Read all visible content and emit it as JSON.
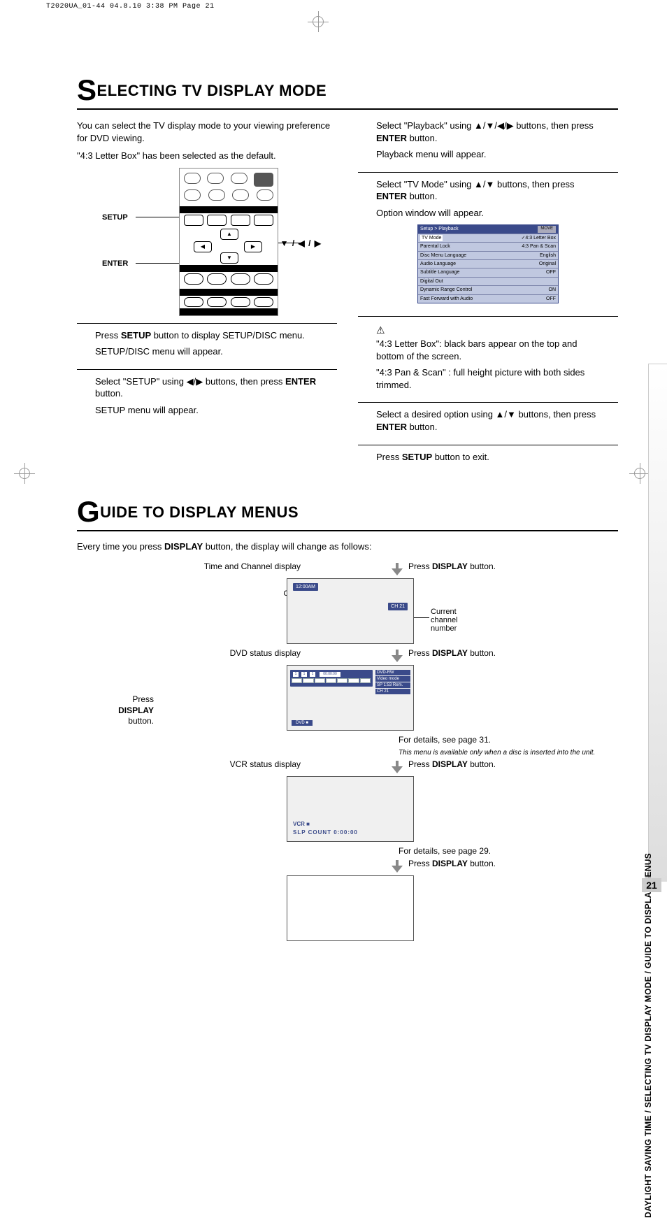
{
  "header_meta": "T2020UA_01-44  04.8.10 3:38 PM  Page 21",
  "section1": {
    "title_rest": "ELECTING TV DISPLAY MODE",
    "big": "S",
    "intro1": "You can select the TV display mode to your viewing preference for DVD viewing.",
    "intro2": "\"4:3 Letter Box\" has been selected as the default.",
    "remote": {
      "setup": "SETUP",
      "enter": "ENTER",
      "arrows": "▲ / ▼ / ◀ / ▶"
    },
    "left_steps": {
      "s1a": "Press SETUP button to display SETUP/DISC menu.",
      "s1b": "SETUP/DISC menu will appear.",
      "s2a": "Select \"SETUP\" using ◀/▶ buttons, then press ENTER button.",
      "s2b": "SETUP menu will appear."
    },
    "right_steps": {
      "s3a": "Select \"Playback\" using ▲/▼/◀/▶ buttons, then press ENTER button.",
      "s3b": "Playback menu will appear.",
      "s4a": "Select \"TV Mode\" using  ▲/▼ buttons, then press ENTER button.",
      "s4b": "Option window will appear.",
      "note1": "\"4:3 Letter Box\": black bars appear on the top and bottom of the screen.",
      "note2": "\"4:3 Pan & Scan\" : full height picture with both sides trimmed.",
      "s5a": "Select a desired option using ▲/▼ buttons, then press ENTER button.",
      "s6a": "Press SETUP button to exit."
    },
    "menu": {
      "title": "Setup > Playback",
      "move": "MOVE",
      "rows": [
        {
          "k": "TV Mode",
          "v": "✓4:3 Letter Box"
        },
        {
          "k": "Parental Lock",
          "v": "4:3 Pan & Scan"
        },
        {
          "k": "Disc Menu Language",
          "v": "English"
        },
        {
          "k": "Audio Language",
          "v": "Original"
        },
        {
          "k": "Subtitle Language",
          "v": "OFF"
        },
        {
          "k": "Digital Out",
          "v": ""
        },
        {
          "k": "Dynamic Range Control",
          "v": "ON"
        },
        {
          "k": "Fast Forward with Audio",
          "v": "OFF"
        }
      ]
    }
  },
  "section2": {
    "big": "G",
    "title_rest": "UIDE TO DISPLAY MENUS",
    "intro": "Every time you press DISPLAY button, the display will change as follows:",
    "labels": {
      "time_channel": "Time and Channel display",
      "current_time": "Current time",
      "current_channel": "Current channel number",
      "dvd": "DVD status display",
      "vcr": "VCR status display",
      "press": "Press DISPLAY button.",
      "left_press": "Press DISPLAY button."
    },
    "screens": {
      "time": "12:00AM",
      "channel": "CH 21",
      "dvd_tag1": "DVD-RW",
      "dvd_tag2": "Video mode",
      "dvd_tag3": "SP 1:53 Rem.",
      "dvd_tag4": "CH 21",
      "dvd_time": "00:00:00",
      "dvd_foot": "DVD  ■",
      "vcr_l1": "VCR ■",
      "vcr_l2": "SLP        COUNT     0:00:00"
    },
    "notes": {
      "p31": "For details, see page 31.",
      "avail": "This menu is available only when a disc is inserted into the unit.",
      "p29": "For details, see page 29."
    }
  },
  "side_text": "DAYLIGHT SAVING TIME / SELECTING TV DISPLAY MODE / GUIDE TO DISPLAY MENUS",
  "page_number": "21"
}
